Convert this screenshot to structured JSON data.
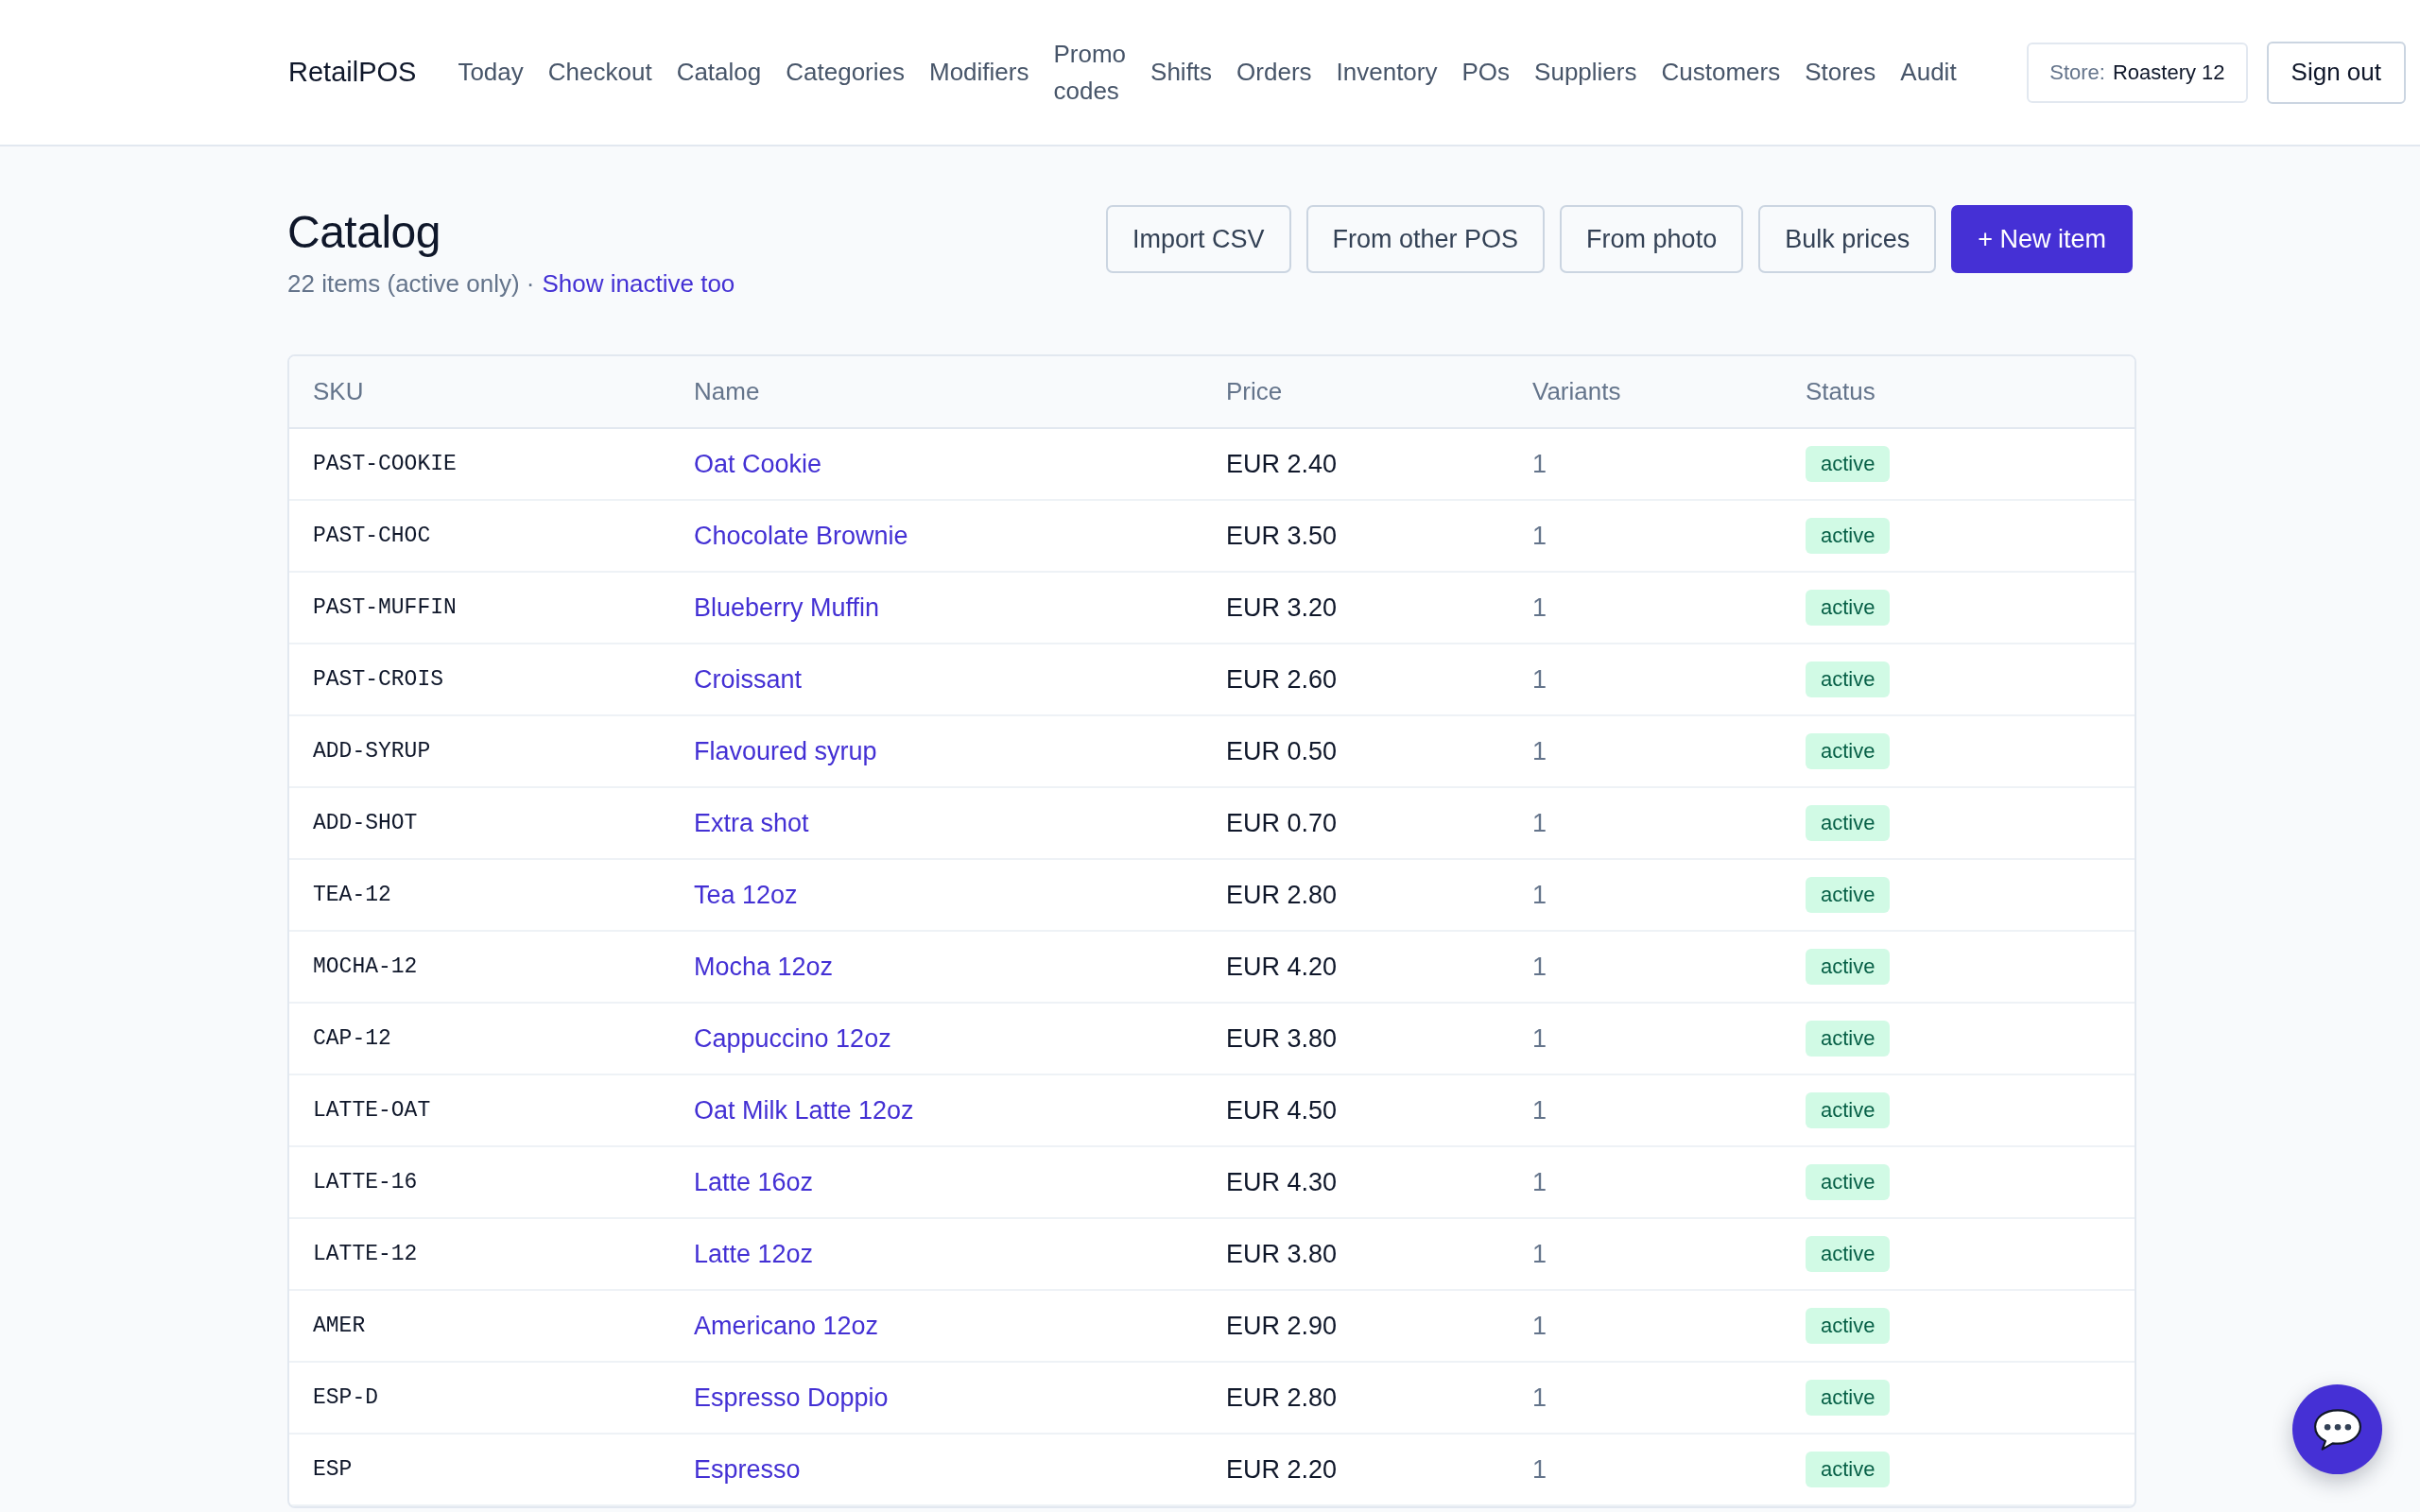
{
  "header": {
    "brand": "RetailPOS",
    "nav": [
      "Today",
      "Checkout",
      "Catalog",
      "Categories",
      "Modifiers",
      "Promo codes",
      "Shifts",
      "Orders",
      "Inventory",
      "POs",
      "Suppliers",
      "Customers",
      "Stores",
      "Audit"
    ],
    "store_select": {
      "label": "Store:",
      "value": "Roastery 12"
    },
    "sign_out": "Sign out"
  },
  "page": {
    "title": "Catalog",
    "summary": "22 items (active only) ·",
    "summary_link": "Show inactive too",
    "actions": [
      {
        "label": "Import CSV",
        "kind": "secondary"
      },
      {
        "label": "From other POS",
        "kind": "secondary"
      },
      {
        "label": "From photo",
        "kind": "secondary"
      },
      {
        "label": "Bulk prices",
        "kind": "secondary"
      },
      {
        "label": "+ New item",
        "kind": "primary"
      }
    ]
  },
  "table": {
    "columns": [
      "SKU",
      "Name",
      "Price",
      "Variants",
      "Status"
    ],
    "rows": [
      {
        "sku": "PAST-COOKIE",
        "name": "Oat Cookie",
        "price": "EUR 2.40",
        "variants": "1",
        "status": "active"
      },
      {
        "sku": "PAST-CHOC",
        "name": "Chocolate Brownie",
        "price": "EUR 3.50",
        "variants": "1",
        "status": "active"
      },
      {
        "sku": "PAST-MUFFIN",
        "name": "Blueberry Muffin",
        "price": "EUR 3.20",
        "variants": "1",
        "status": "active"
      },
      {
        "sku": "PAST-CROIS",
        "name": "Croissant",
        "price": "EUR 2.60",
        "variants": "1",
        "status": "active"
      },
      {
        "sku": "ADD-SYRUP",
        "name": "Flavoured syrup",
        "price": "EUR 0.50",
        "variants": "1",
        "status": "active"
      },
      {
        "sku": "ADD-SHOT",
        "name": "Extra shot",
        "price": "EUR 0.70",
        "variants": "1",
        "status": "active"
      },
      {
        "sku": "TEA-12",
        "name": "Tea 12oz",
        "price": "EUR 2.80",
        "variants": "1",
        "status": "active"
      },
      {
        "sku": "MOCHA-12",
        "name": "Mocha 12oz",
        "price": "EUR 4.20",
        "variants": "1",
        "status": "active"
      },
      {
        "sku": "CAP-12",
        "name": "Cappuccino 12oz",
        "price": "EUR 3.80",
        "variants": "1",
        "status": "active"
      },
      {
        "sku": "LATTE-OAT",
        "name": "Oat Milk Latte 12oz",
        "price": "EUR 4.50",
        "variants": "1",
        "status": "active"
      },
      {
        "sku": "LATTE-16",
        "name": "Latte 16oz",
        "price": "EUR 4.30",
        "variants": "1",
        "status": "active"
      },
      {
        "sku": "LATTE-12",
        "name": "Latte 12oz",
        "price": "EUR 3.80",
        "variants": "1",
        "status": "active"
      },
      {
        "sku": "AMER",
        "name": "Americano 12oz",
        "price": "EUR 2.90",
        "variants": "1",
        "status": "active"
      },
      {
        "sku": "ESP-D",
        "name": "Espresso Doppio",
        "price": "EUR 2.80",
        "variants": "1",
        "status": "active"
      },
      {
        "sku": "ESP",
        "name": "Espresso",
        "price": "EUR 2.20",
        "variants": "1",
        "status": "active"
      }
    ]
  }
}
